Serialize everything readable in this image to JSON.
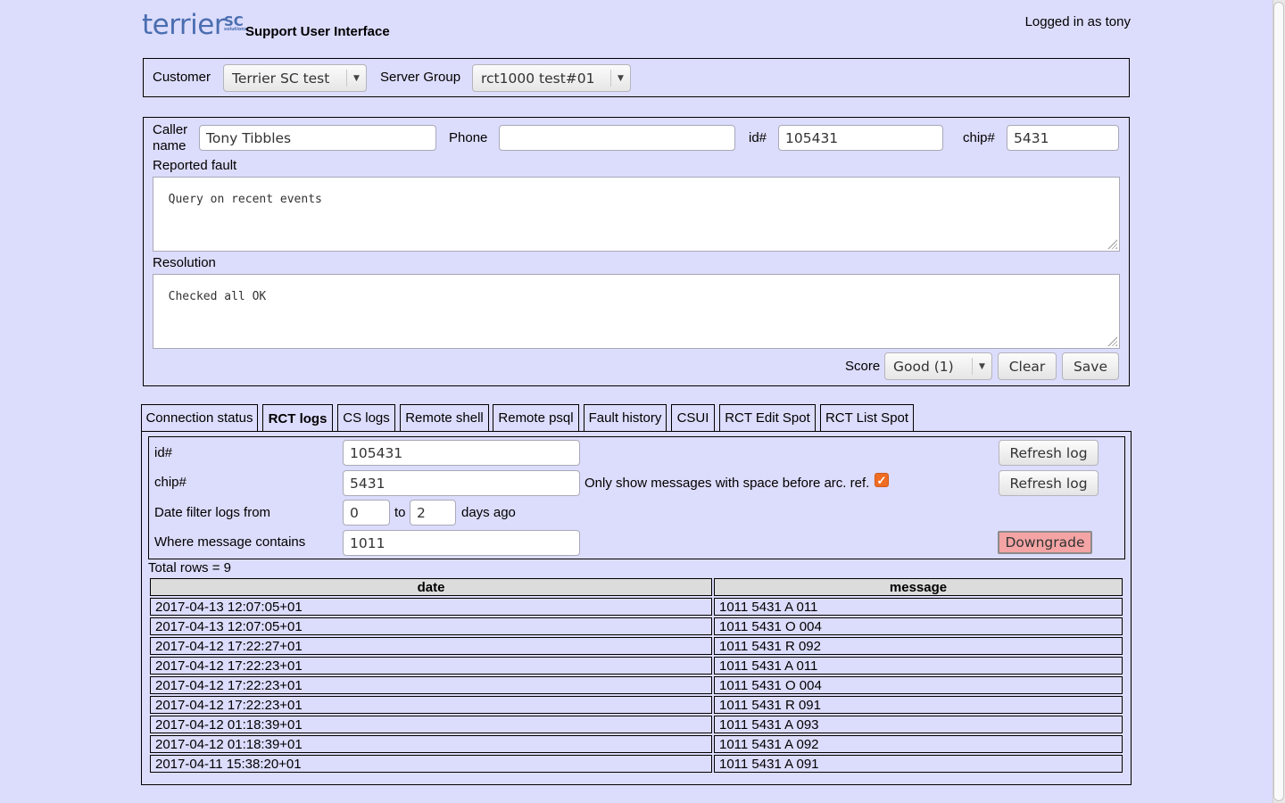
{
  "header": {
    "logo_text": "terrier",
    "logo_sc": "SC",
    "logo_sub": "solutions",
    "app_title": "Support User Interface",
    "logged_in": "Logged in as tony"
  },
  "selector": {
    "customer_label": "Customer",
    "customer_value": "Terrier SC test",
    "server_group_label": "Server Group",
    "server_group_value": "rct1000 test#01"
  },
  "call": {
    "caller_label_1": "Caller",
    "caller_label_2": "name",
    "caller_value": "Tony Tibbles",
    "phone_label": "Phone",
    "phone_value": "",
    "id_label": "id#",
    "id_value": "105431",
    "chip_label": "chip#",
    "chip_value": "5431",
    "fault_label": "Reported fault",
    "fault_value": "Query on recent events",
    "resolution_label": "Resolution",
    "resolution_value": "Checked all OK",
    "score_label": "Score",
    "score_value": "Good (1)",
    "clear_label": "Clear",
    "save_label": "Save"
  },
  "tabs": [
    {
      "label": "Connection status",
      "active": false
    },
    {
      "label": "RCT logs",
      "active": true
    },
    {
      "label": "CS logs",
      "active": false
    },
    {
      "label": "Remote shell",
      "active": false
    },
    {
      "label": "Remote psql",
      "active": false
    },
    {
      "label": "Fault history",
      "active": false
    },
    {
      "label": "CSUI",
      "active": false
    },
    {
      "label": "RCT Edit Spot",
      "active": false
    },
    {
      "label": "RCT List Spot",
      "active": false
    }
  ],
  "rct_logs": {
    "id_label": "id#",
    "id_value": "105431",
    "chip_label": "chip#",
    "chip_value": "5431",
    "only_show_label": "Only show messages with space before arc. ref.",
    "only_show_checked": true,
    "date_filter_label": "Date filter logs from",
    "date_from": "0",
    "to_label": "to",
    "date_to": "2",
    "days_ago_label": "days ago",
    "where_label": "Where message contains",
    "where_value": "1011",
    "refresh_label_1": "Refresh log",
    "refresh_label_2": "Refresh log",
    "downgrade_label": "Downgrade",
    "total_rows": "Total rows = 9",
    "columns": [
      "date",
      "message"
    ],
    "rows": [
      [
        "2017-04-13 12:07:05+01",
        "1011 5431 A 011"
      ],
      [
        "2017-04-13 12:07:05+01",
        "1011 5431 O 004"
      ],
      [
        "2017-04-12 17:22:27+01",
        "1011 5431 R 092"
      ],
      [
        "2017-04-12 17:22:23+01",
        "1011 5431 A 011"
      ],
      [
        "2017-04-12 17:22:23+01",
        "1011 5431 O 004"
      ],
      [
        "2017-04-12 17:22:23+01",
        "1011 5431 R 091"
      ],
      [
        "2017-04-12 01:18:39+01",
        "1011 5431 A 093"
      ],
      [
        "2017-04-12 01:18:39+01",
        "1011 5431 A 092"
      ],
      [
        "2017-04-11 15:38:20+01",
        "1011 5431 A 091"
      ]
    ]
  }
}
